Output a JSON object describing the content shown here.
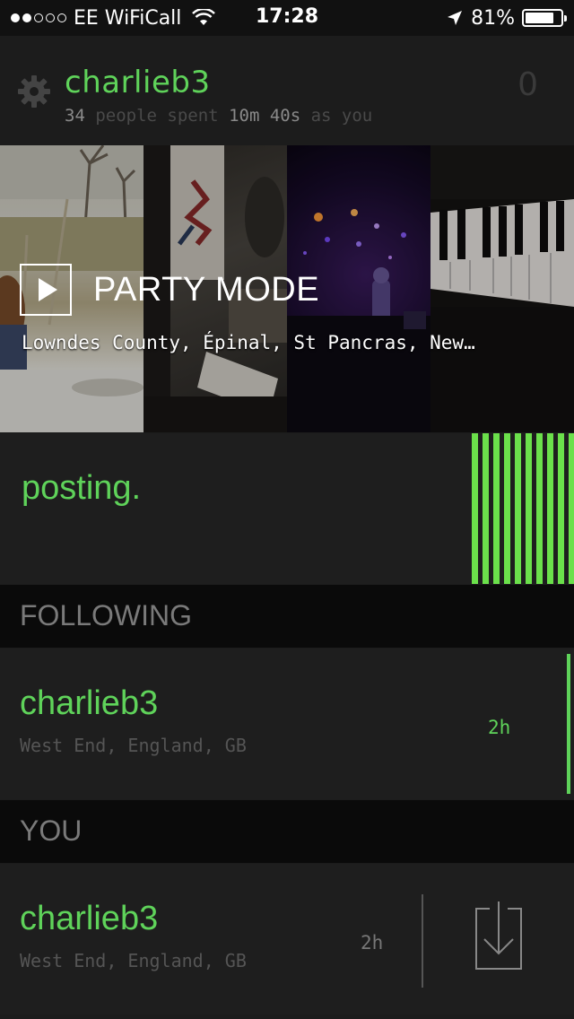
{
  "status_bar": {
    "carrier": "EE WiFiCall",
    "time": "17:28",
    "battery_percent": "81%",
    "battery_level": 0.81,
    "signal_bars_filled": 2,
    "signal_bars_total": 5
  },
  "header": {
    "username": "charlieb3",
    "stats_count": "34",
    "stats_text_1": "people spent",
    "stats_duration": "10m 40s",
    "stats_text_2": "as you",
    "counter": "0"
  },
  "party_mode": {
    "title": "PARTY MODE",
    "places": "Lowndes County, Épinal, St Pancras, New…"
  },
  "posting": {
    "label": "posting."
  },
  "following": {
    "heading": "FOLLOWING",
    "items": [
      {
        "name": "charlieb3",
        "location": "West End, England, GB",
        "age": "2h"
      }
    ]
  },
  "you": {
    "heading": "YOU",
    "items": [
      {
        "name": "charlieb3",
        "location": "West End, England, GB",
        "age": "2h"
      }
    ]
  },
  "colors": {
    "accent": "#5fd35a",
    "background": "#1c1c1c"
  }
}
